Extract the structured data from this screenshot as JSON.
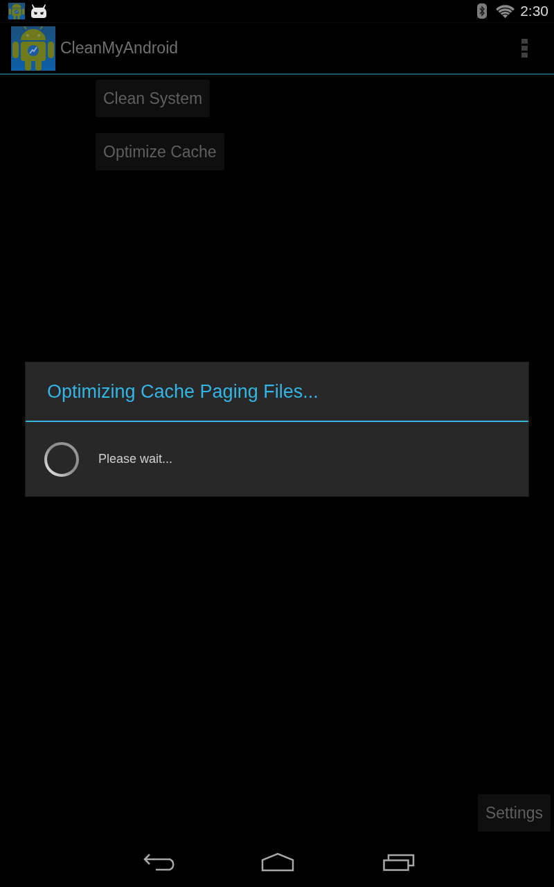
{
  "status_bar": {
    "time": "2:30"
  },
  "action_bar": {
    "title": "CleanMyAndroid"
  },
  "buttons": [
    {
      "label": "Clean System"
    },
    {
      "label": "Optimize Cache"
    }
  ],
  "dialog": {
    "title": "Optimizing Cache Paging Files...",
    "message": "Please wait..."
  },
  "settings_button": {
    "label": "Settings"
  }
}
